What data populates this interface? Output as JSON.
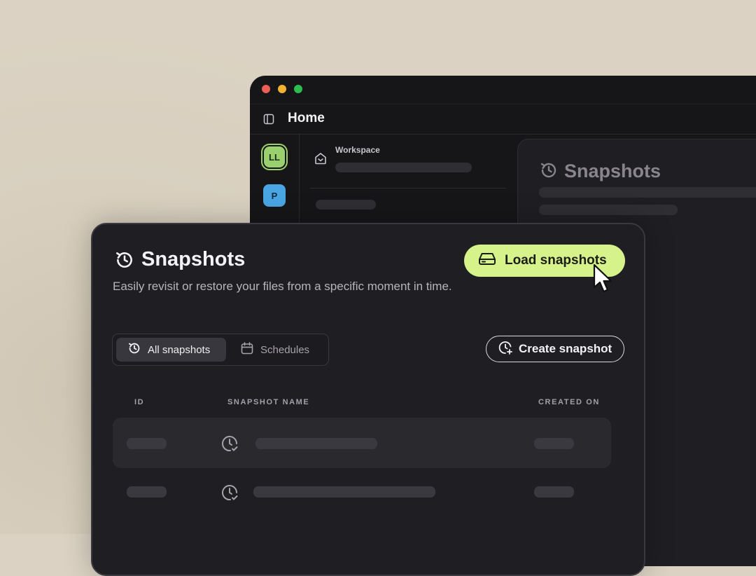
{
  "background_window": {
    "traffic_colors": [
      "#ec5f57",
      "#f2b12f",
      "#2dbd4e"
    ],
    "title": "Home",
    "workspace_label": "Workspace",
    "avatars": [
      {
        "initials": "LL",
        "color": "#9bd06e"
      },
      {
        "initials": "P",
        "color": "#4aa5e3"
      }
    ],
    "card_title": "Snapshots"
  },
  "main": {
    "title": "Snapshots",
    "description": "Easily revisit or restore your files from a specific moment in time.",
    "load_button": "Load snapshots",
    "tabs": [
      {
        "label": "All snapshots",
        "icon": "clock-refresh-icon",
        "active": true
      },
      {
        "label": "Schedules",
        "icon": "calendar-icon",
        "active": false
      }
    ],
    "create_button": "Create snapshot",
    "columns": [
      "ID",
      "SNAPSHOT NAME",
      "CREATED ON"
    ],
    "rows": [
      {
        "icon": "snapshot-clock-icon",
        "highlighted": true
      },
      {
        "icon": "snapshot-clock-icon",
        "highlighted": false
      }
    ],
    "accent_color": "#d6f28a"
  }
}
